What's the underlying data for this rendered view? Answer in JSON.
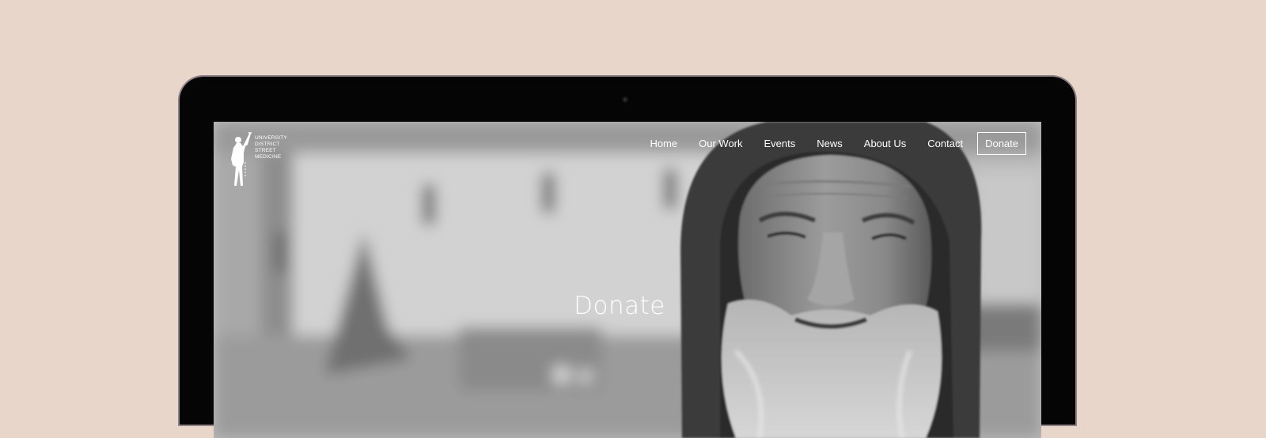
{
  "logo": {
    "lines": [
      "UNIVERSITY",
      "DISTRICT",
      "STREET",
      "MEDICINE"
    ],
    "icon": "silhouette-figure-icon"
  },
  "nav": {
    "items": [
      {
        "label": "Home"
      },
      {
        "label": "Our Work"
      },
      {
        "label": "Events"
      },
      {
        "label": "News"
      },
      {
        "label": "About Us"
      },
      {
        "label": "Contact"
      }
    ],
    "donate_label": "Donate"
  },
  "hero": {
    "title": "Donate"
  },
  "colors": {
    "background": "#e9d6cb",
    "bezel": "#050505",
    "text": "#ffffff"
  }
}
